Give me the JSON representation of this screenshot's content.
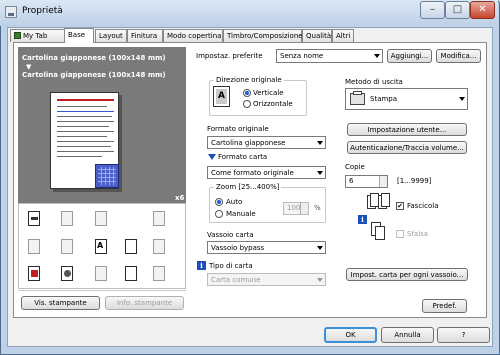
{
  "window": {
    "title": "Proprietà",
    "caption": {
      "minimize": "–",
      "maximize": "□",
      "close": "✕"
    }
  },
  "tabs": [
    "My Tab",
    "Base",
    "Layout",
    "Finitura",
    "Modo copertina",
    "Timbro/Composizione",
    "Qualità",
    "Altri"
  ],
  "active_tab": "Base",
  "preview": {
    "paper_line1": "Cartolina giapponese (100x148 mm)",
    "arrow": "▼",
    "paper_line2": "Cartolina giapponese (100x148 mm)",
    "copies_badge": "x6"
  },
  "left_buttons": {
    "view_printer": "Vis. stampante",
    "printer_info": "Info. stampante"
  },
  "favorites": {
    "label": "Impostaz. preferite",
    "value": "Senza nome",
    "add_button": "Aggiungi...",
    "modify_button": "Modifica..."
  },
  "orientation": {
    "title": "Direzione originale",
    "option_portrait": "Verticale",
    "option_landscape": "Orizzontale",
    "selected": "Verticale"
  },
  "original_size": {
    "label": "Formato originale",
    "value": "Cartolina giapponese"
  },
  "paper_size": {
    "label": "Formato carta",
    "value": "Come formato originale"
  },
  "zoom": {
    "title": "Zoom [25...400%]",
    "option_auto": "Auto",
    "option_manual": "Manuale",
    "selected": "Auto",
    "value": "100",
    "unit": "%"
  },
  "paper_tray": {
    "label": "Vassoio carta",
    "value": "Vassoio bypass"
  },
  "paper_type": {
    "label": "Tipo di carta",
    "value": "Carta comune"
  },
  "output_method": {
    "label": "Metodo di uscita",
    "value": "Stampa",
    "user_settings_button": "Impostazione utente...",
    "auth_button": "Autenticazione/Traccia volume..."
  },
  "copies": {
    "label": "Copie",
    "value": "6",
    "range": "[1...9999]"
  },
  "collate": {
    "label": "Fascicola",
    "checked": true,
    "check_glyph": "✔"
  },
  "offset": {
    "label": "Sfalsa",
    "checked": false
  },
  "paper_per_tray_button": "Impost. carta per ogni vassoio...",
  "default_button": "Predef.",
  "footer": {
    "ok": "OK",
    "cancel": "Annulla",
    "help": "?"
  },
  "icons": {
    "info": "i"
  },
  "colors": {
    "accent": "#1c5ad6",
    "info_icon": "#1b4fb8",
    "preview_bg": "#7a7a7a"
  }
}
